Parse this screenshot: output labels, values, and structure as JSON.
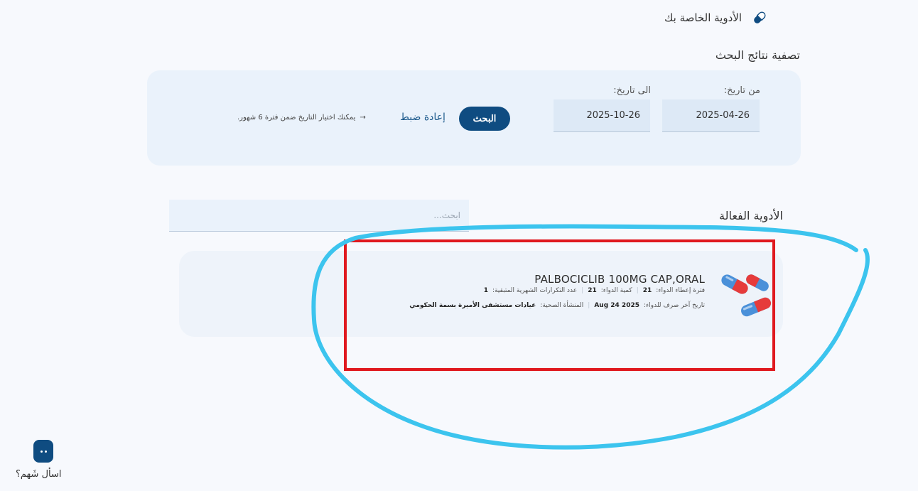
{
  "header": {
    "title": "الأدوية الخاصة بك",
    "icon": "pill-icon"
  },
  "filter": {
    "title": "تصفية نتائج البحث",
    "from_label": "من تاريخ:",
    "from_value": "2025-04-26",
    "to_label": "الى تاريخ:",
    "to_value": "2025-10-26",
    "search_label": "البحث",
    "reset_label": "إعادة ضبط",
    "hint": "يمكنك اختيار التاريخ ضمن فترة 6 شهور.",
    "hint_arrow": "→"
  },
  "active_meds": {
    "title": "الأدوية الفعالة",
    "search_placeholder": "ابحث...",
    "items": [
      {
        "name": "PALBOCICLIB 100MG CAP,ORAL",
        "period_label": "فترة إعطاء الدواء:",
        "period_value": "21",
        "qty_label": "كمية الدواء:",
        "qty_value": "21",
        "refills_label": "عدد التكرارات الشهرية المتبقية:",
        "refills_value": "1",
        "last_dispense_label": "تاريخ آخر صرف للدواء:",
        "last_dispense_value": "Aug 24 2025",
        "facility_label": "المنشأة الصحية:",
        "facility_value": "عيادات مستشفى الأميرة بسمة الحكومي"
      }
    ]
  },
  "chatbot": {
    "label": "اسأل شَهم؟"
  },
  "colors": {
    "primary": "#0f4c81",
    "annotation_red": "#e0191f",
    "annotation_blue": "#3cc4ee"
  }
}
